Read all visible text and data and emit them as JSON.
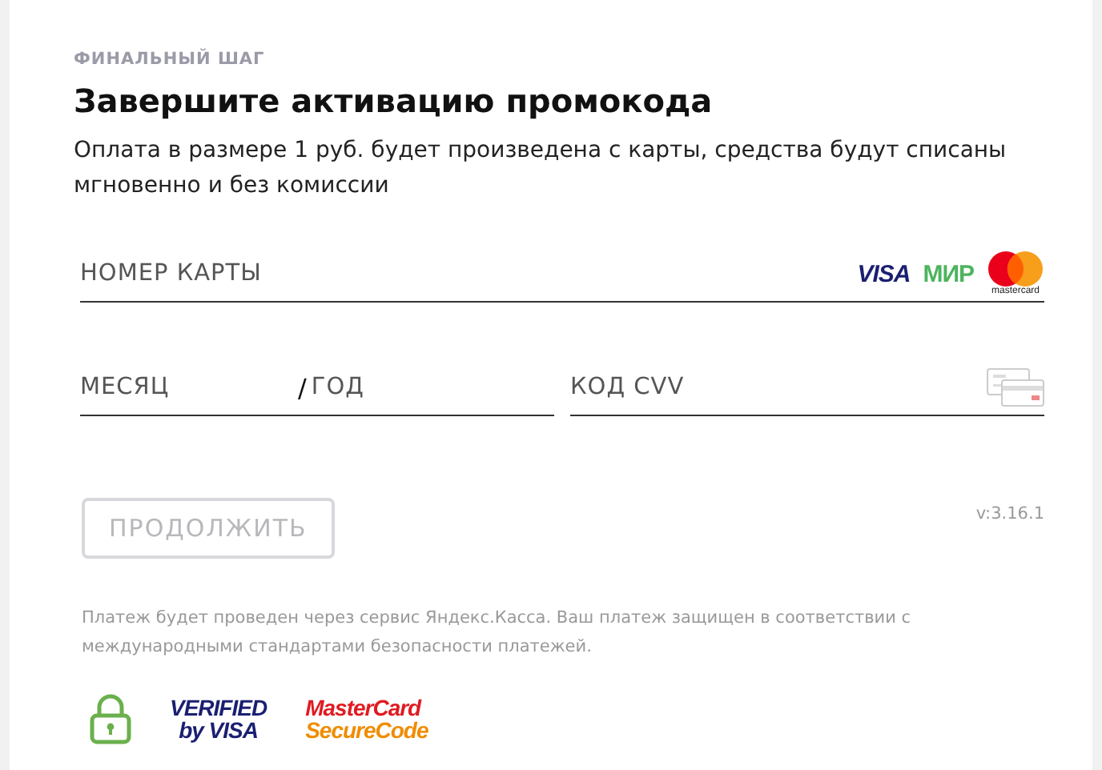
{
  "step": "ФИНАЛЬНЫЙ ШАГ",
  "title": "Завершите активацию промокода",
  "description": "Оплата в размере 1 руб. будет произведена с карты, средства будут списаны мгновенно и без комиссии",
  "card_number": {
    "placeholder": "НОМЕР КАРТЫ"
  },
  "card_brands": [
    {
      "kind": "visa",
      "label": "VISA"
    },
    {
      "kind": "mir",
      "label": "МИР"
    },
    {
      "kind": "mastercard",
      "label": "mastercard"
    }
  ],
  "expiry": {
    "month_placeholder": "МЕСЯЦ",
    "separator": "/",
    "year_placeholder": "ГОД"
  },
  "cvv": {
    "placeholder": "КОД CVV"
  },
  "continue_button": {
    "label": "ПРОДОЛЖИТЬ",
    "disabled": true
  },
  "version": "v:3.16.1",
  "security_note": "Платеж будет проведен через сервис Яндекс.Касса. Ваш платеж защищен в соответствии с международными стандартами безопасности платежей.",
  "security_badges": [
    {
      "kind": "verified-by-visa",
      "lines": [
        "VERIFIED",
        "by VISA"
      ]
    },
    {
      "kind": "mastercard-securecode",
      "lines": [
        "MasterCard",
        "SecureCode"
      ]
    }
  ]
}
